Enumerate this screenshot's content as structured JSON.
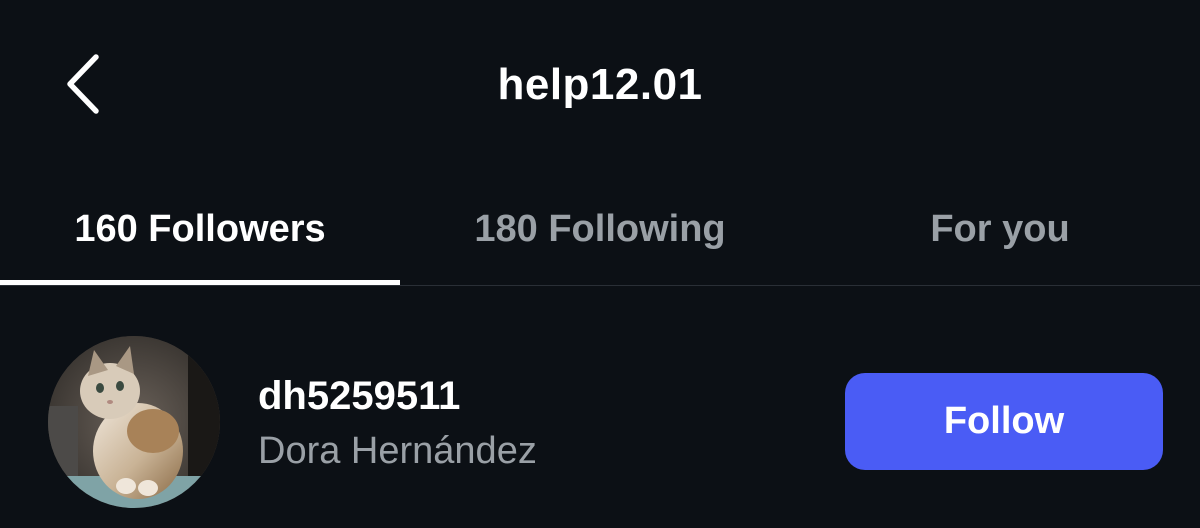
{
  "header": {
    "title": "help12.01",
    "back_icon": "chevron-left-icon"
  },
  "tabs": [
    {
      "label": "160 Followers",
      "active": true
    },
    {
      "label": "180 Following",
      "active": false
    },
    {
      "label": "For you",
      "active": false
    }
  ],
  "list": [
    {
      "username": "dh5259511",
      "display_name": "Dora Hernández",
      "avatar": "cat-photo-avatar",
      "action_label": "Follow"
    }
  ],
  "colors": {
    "background": "#0c1015",
    "accent": "#4a5cf5",
    "muted_text": "#9aa0a6",
    "divider": "#2a2f36"
  }
}
